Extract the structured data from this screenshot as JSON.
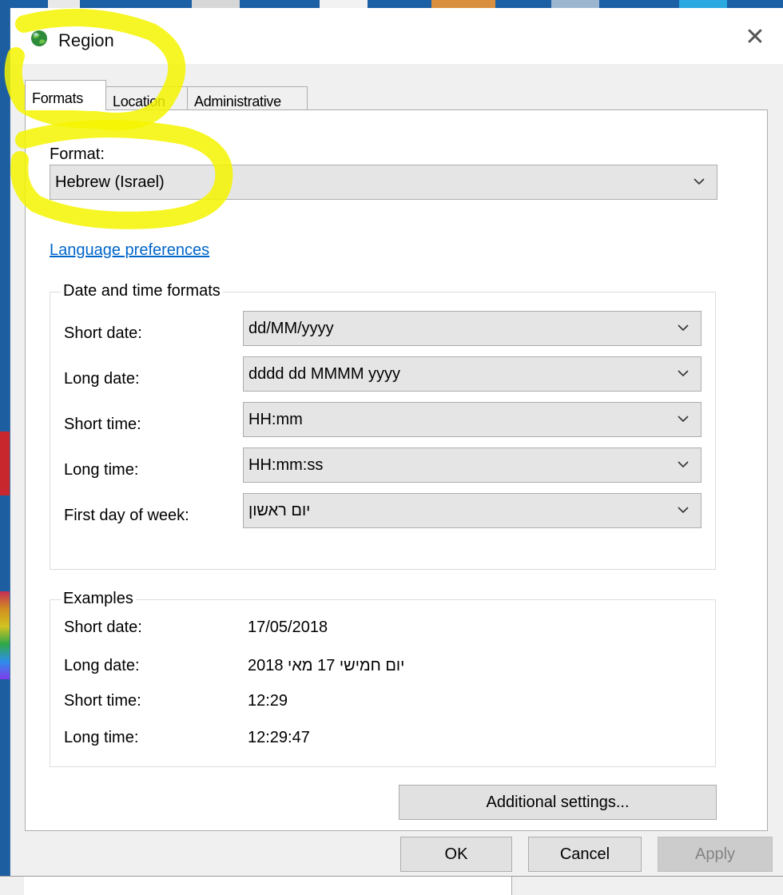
{
  "window": {
    "title": "Region",
    "close_glyph": "✕"
  },
  "tabs": [
    {
      "label": "Formats",
      "active": true
    },
    {
      "label": "Location",
      "active": false
    },
    {
      "label": "Administrative",
      "active": false
    }
  ],
  "format": {
    "label": "Format:",
    "value": "Hebrew (Israel)"
  },
  "language_link": "Language preferences",
  "date_time": {
    "group_title": "Date and time formats",
    "rows": [
      {
        "label": "Short date:",
        "value": "dd/MM/yyyy"
      },
      {
        "label": "Long date:",
        "value": "dddd dd MMMM yyyy"
      },
      {
        "label": "Short time:",
        "value": "HH:mm"
      },
      {
        "label": "Long time:",
        "value": "HH:mm:ss"
      },
      {
        "label": "First day of week:",
        "value": "יום ראשון"
      }
    ]
  },
  "examples": {
    "group_title": "Examples",
    "rows": [
      {
        "label": "Short date:",
        "value": "17/05/2018"
      },
      {
        "label": "Long date:",
        "value": "יום חמישי 17 מאי 2018"
      },
      {
        "label": "Short time:",
        "value": "12:29"
      },
      {
        "label": "Long time:",
        "value": "12:29:47"
      }
    ]
  },
  "buttons": {
    "additional_settings": "Additional settings...",
    "ok": "OK",
    "cancel": "Cancel",
    "apply": "Apply"
  },
  "icons": {
    "app": "globe-icon",
    "dropdown": "chevron-down-icon"
  },
  "colors": {
    "link": "#0066cc",
    "highlight": "#f5f500",
    "desktop": "#1b5fa4"
  }
}
